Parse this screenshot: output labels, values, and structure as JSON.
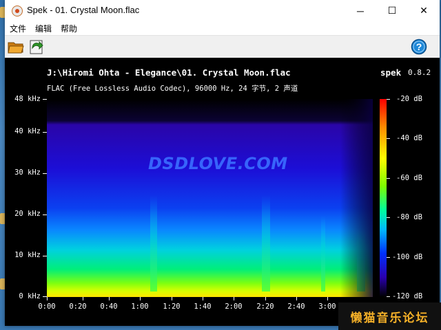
{
  "window": {
    "title": "Spek - 01. Crystal Moon.flac",
    "controls": {
      "minimize": "─",
      "maximize": "☐",
      "close": "✕"
    }
  },
  "menu": [
    "文件",
    "编辑",
    "帮助"
  ],
  "toolbar": {
    "open_icon": "folder-open-icon",
    "save_icon": "save-export-icon",
    "help_icon": "help-icon",
    "help_glyph": "?"
  },
  "spectrogram": {
    "file_path": "J:\\Hiromi Ohta - Elegance\\01. Crystal Moon.flac",
    "info": "FLAC (Free Lossless Audio Codec), 96000 Hz, 24 字节, 2 声道",
    "app_name": "spek",
    "app_version": "0.8.2",
    "freq_labels": [
      "48 kHz",
      "40 kHz",
      "30 kHz",
      "20 kHz",
      "10 kHz",
      "0 kHz"
    ],
    "time_labels": [
      "0:00",
      "0:20",
      "0:40",
      "1:00",
      "1:20",
      "1:40",
      "2:00",
      "2:20",
      "2:40",
      "3:00"
    ],
    "db_labels": [
      "-20 dB",
      "-40 dB",
      "-60 dB",
      "-80 dB",
      "-100 dB",
      "-120 dB"
    ]
  },
  "watermark": "DSDLOVE.COM",
  "banner": "懒猫音乐论坛",
  "colors": {
    "accent": "#1e88d8",
    "background": "#000000",
    "text": "#ffffff"
  }
}
